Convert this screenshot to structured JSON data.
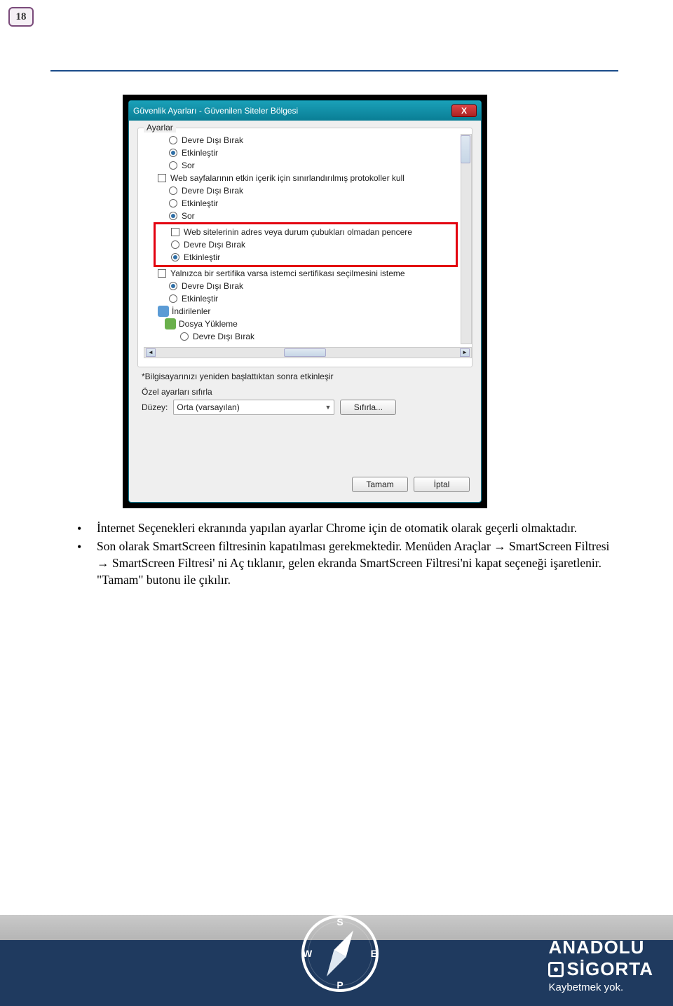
{
  "page_number": "18",
  "dialog": {
    "title": "Güvenlik Ayarları - Güvenilen Siteler Bölgesi",
    "group_label": "Ayarlar",
    "items": {
      "r1": "Devre Dışı Bırak",
      "r2": "Etkinleştir",
      "r3": "Sor",
      "c1": "Web sayfalarının etkin içerik için sınırlandırılmış protokoller kull",
      "r4": "Devre Dışı Bırak",
      "r5": "Etkinleştir",
      "r6": "Sor",
      "c2": "Web sitelerinin adres veya durum çubukları olmadan pencere",
      "r7": "Devre Dışı Bırak",
      "r8": "Etkinleştir",
      "c3": "Yalnızca bir sertifika varsa istemci sertifikası seçilmesini isteme",
      "r9": "Devre Dışı Bırak",
      "r10": "Etkinleştir",
      "n1": "İndirilenler",
      "n2": "Dosya Yükleme",
      "r11": "Devre Dışı Bırak"
    },
    "note": "*Bilgisayarınızı yeniden başlattıktan sonra etkinleşir",
    "reset_label": "Özel ayarları sıfırla",
    "level_label": "Düzey:",
    "level_value": "Orta (varsayılan)",
    "reset_button": "Sıfırla...",
    "ok": "Tamam",
    "cancel": "İptal"
  },
  "body": {
    "p1": "İnternet Seçenekleri ekranında yapılan ayarlar Chrome için de otomatik olarak geçerli olmaktadır.",
    "p2": "Son olarak SmartScreen filtresinin kapatılması gerekmektedir. Menüden Araçlar → SmartScreen Filtresi → SmartScreen Filtresi' ni Aç tıklanır, gelen ekranda SmartScreen Filtresi'ni kapat seçeneği işaretlenir. \"Tamam\" butonu ile çıkılır."
  },
  "compass": {
    "n": "S",
    "s": "P",
    "e": "E",
    "w": "W"
  },
  "brand": {
    "l1": "ANADOLU",
    "l2": "SİGORTA",
    "tag": "Kaybetmek yok."
  }
}
